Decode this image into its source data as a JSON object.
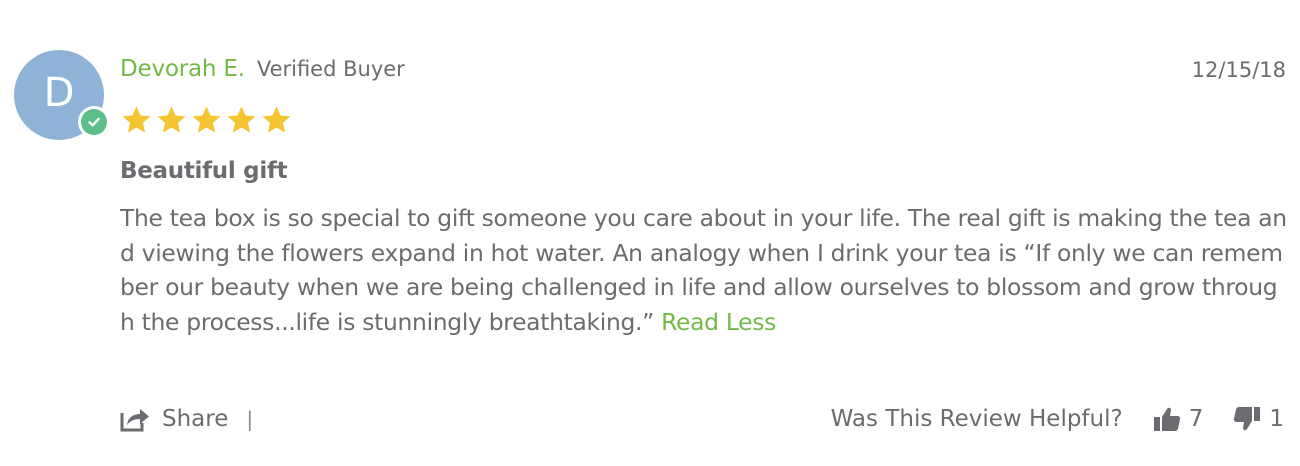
{
  "review": {
    "avatar_initial": "D",
    "author": "Devorah E.",
    "verified_label": "Verified Buyer",
    "date": "12/15/18",
    "rating": 5,
    "rating_max": 5,
    "title": "Beautiful gift",
    "body": "The tea box is so special to gift someone you care about in your life. The real gift is making the tea and viewing the flowers expand in hot water. An analogy when I drink your tea is “If only we can remember our beauty when we are being challenged in life and allow ourselves to blossom and grow through the process...life is stunningly breathtaking.”",
    "read_less_label": "Read Less"
  },
  "footer": {
    "share_label": "Share",
    "divider": "|",
    "helpful_label": "Was This Review Helpful?",
    "upvotes": "7",
    "downvotes": "1"
  },
  "colors": {
    "author_green": "#74b947",
    "avatar_blue": "#8fb3d6",
    "verified_badge_green": "#5cbf8a",
    "star_gold": "#f5c431",
    "text_gray": "#6b6b70"
  },
  "icons": {
    "verified": "check-circle-icon",
    "star": "star-icon",
    "share": "share-icon",
    "thumbs_up": "thumbs-up-icon",
    "thumbs_down": "thumbs-down-icon"
  }
}
